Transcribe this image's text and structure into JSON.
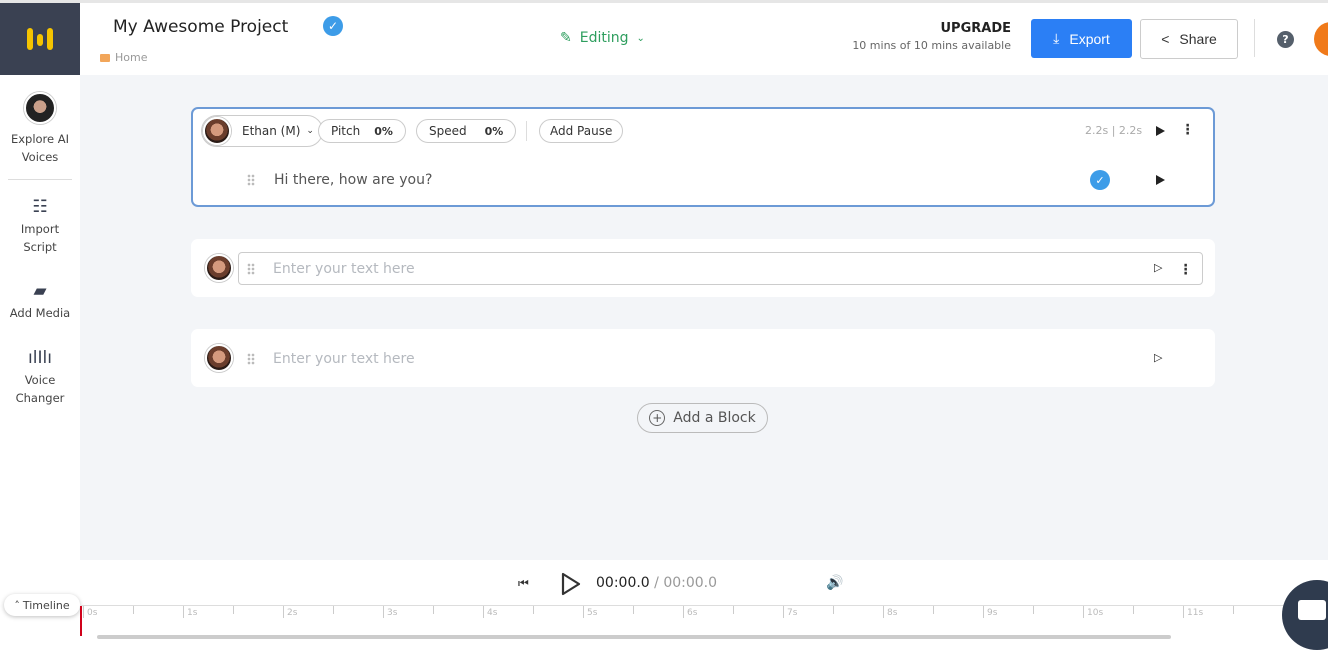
{
  "header": {
    "project_title": "My Awesome Project",
    "breadcrumb": "Home",
    "mode": "Editing",
    "upgrade_label": "UPGRADE",
    "usage": "10 mins of 10 mins available",
    "export_label": "Export",
    "share_label": "Share",
    "help": "?"
  },
  "sidebar": {
    "items": [
      {
        "label1": "Explore AI",
        "label2": "Voices"
      },
      {
        "label1": "Import",
        "label2": "Script",
        "icon": "import-script-icon"
      },
      {
        "label1": "Add Media",
        "label2": "",
        "icon": "add-media-icon"
      },
      {
        "label1": "Voice",
        "label2": "Changer",
        "icon": "voice-changer-icon"
      }
    ]
  },
  "blocks": [
    {
      "voice": "Ethan (M)",
      "pitch_label": "Pitch",
      "pitch": "0%",
      "speed_label": "Speed",
      "speed": "0%",
      "pause_label": "Add Pause",
      "duration": "2.2s | 2.2s",
      "text": "Hi there, how are you?"
    },
    {
      "placeholder": "Enter your text here"
    },
    {
      "placeholder": "Enter your text here"
    }
  ],
  "add_block_label": "Add a Block",
  "player": {
    "current": "00:00.0",
    "total": "/ 00:00.0"
  },
  "timeline": {
    "label": "Timeline",
    "ticks": [
      "0s",
      "1s",
      "2s",
      "3s",
      "4s",
      "5s",
      "6s",
      "7s",
      "8s",
      "9s",
      "10s",
      "11s"
    ]
  },
  "colors": {
    "accent": "#2b7ff5",
    "editing": "#2e9e5e",
    "logo_bg": "#3a4152",
    "logo": "#f5c400",
    "playhead": "#d0021b"
  }
}
